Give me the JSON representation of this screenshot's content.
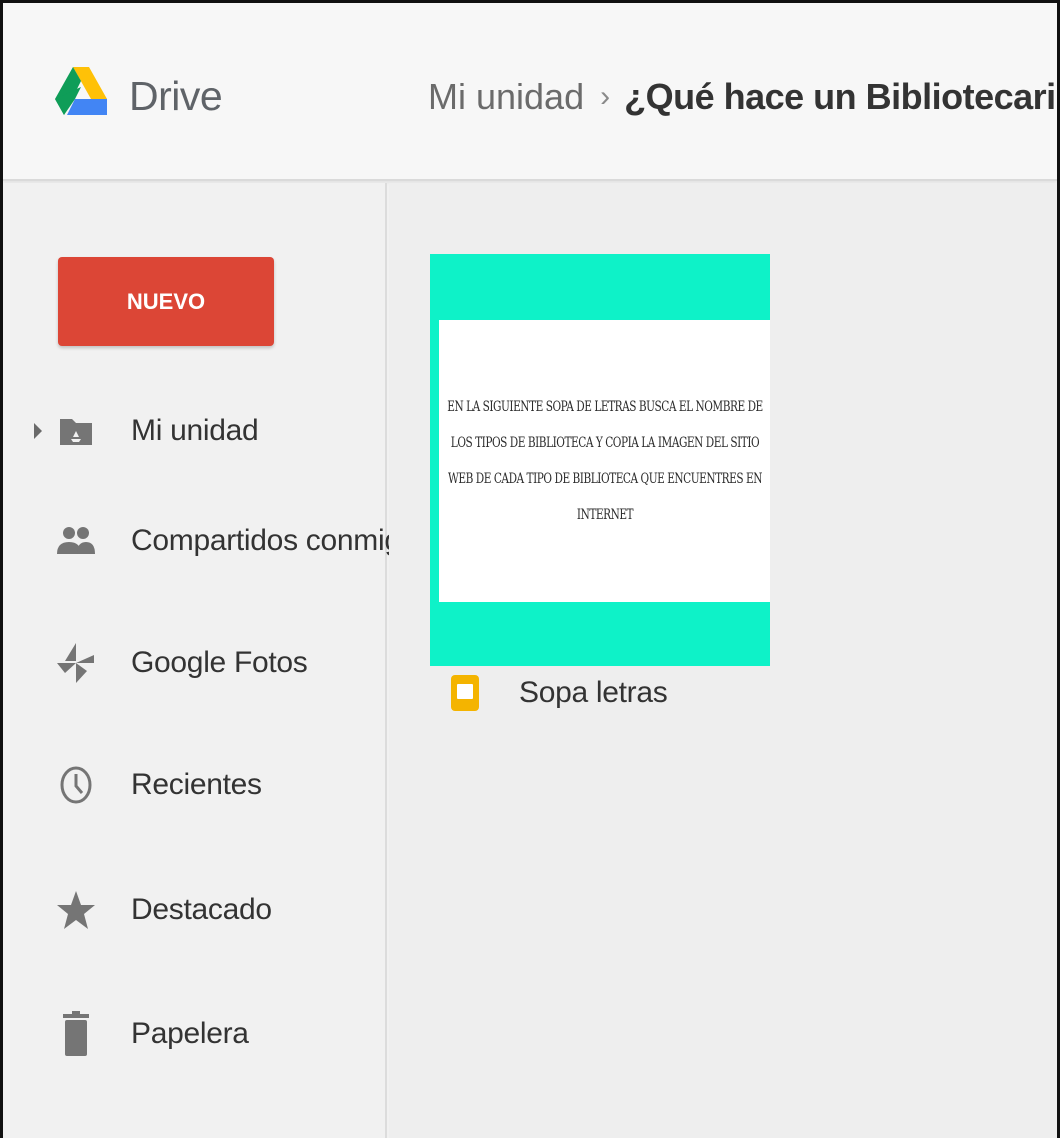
{
  "app": {
    "title": "Drive",
    "logo_icon": "google-drive-logo"
  },
  "breadcrumb": {
    "root": "Mi unidad",
    "separator": "›",
    "current": "¿Qué hace un Bibliotecario?",
    "caret": "▼"
  },
  "sidebar": {
    "new_label": "NUEVO",
    "items": [
      {
        "label": "Mi unidad",
        "icon": "my-drive-folder-icon"
      },
      {
        "label": "Compartidos conmigo",
        "icon": "people-icon"
      },
      {
        "label": "Google Fotos",
        "icon": "google-photos-icon"
      },
      {
        "label": "Recientes",
        "icon": "clock-icon"
      },
      {
        "label": "Destacado",
        "icon": "star-icon"
      },
      {
        "label": "Papelera",
        "icon": "trash-icon"
      }
    ]
  },
  "files": [
    {
      "name": "Sopa letras",
      "type_icon": "google-slides-icon",
      "thumbnail_text": "En la siguiente sopa de letras busca el nombre de los tipos de biblioteca y copia la imagen del sitio web de cada tipo de biblioteca que encuentres en Internet"
    }
  ],
  "colors": {
    "new_button": "#dc4636",
    "thumbnail_accent": "#0ef2c8",
    "slides_icon": "#f4b400"
  }
}
